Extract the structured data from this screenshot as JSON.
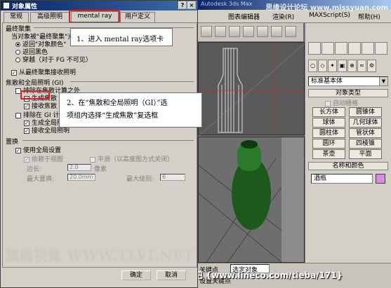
{
  "max_window": {
    "title_watermark": "思缘设计论坛 www.missyuan.com",
    "menu_items": [
      "图表编辑器",
      "渲染(R)",
      "MAXScript(S)",
      "帮助(H)"
    ],
    "selection_dropdown": "选定对象",
    "status_label_1": "关键点",
    "status_label_2": "设置关键点",
    "footer_watermark": "3Dmax吧  {www.lineco.com/tieba/171}"
  },
  "command_panel": {
    "category_dropdown": "标准基本体",
    "object_type_header": "对象类型",
    "auto_grid": "自动栅格",
    "buttons": [
      "长方体",
      "圆锥体",
      "球体",
      "几何球体",
      "圆柱体",
      "管状体",
      "圆环",
      "四棱锥",
      "茶壶",
      "平面"
    ],
    "name_color_header": "名称和颜色",
    "object_name": "酒瓶",
    "swatch_color": "#d98bd8"
  },
  "dialog": {
    "title": "对象属性",
    "tabs": [
      "常规",
      "高级照明",
      "mental ray",
      "用户定义"
    ],
    "active_tab": "mental ray",
    "final_gather_group": "最终聚集",
    "fg_when_hit": "当对象被\"最终聚集\"光线击中时",
    "fg_radio_1": "返回\"对象颜色\"",
    "fg_radio_2": "返回黑色",
    "fg_radio_3": "穿越（对于 FG 不可见）",
    "fg_receive": "从最终聚集接收照明",
    "caustics_group": "焦散和全局照明 (GI)",
    "exclude_caustics": "排除在焦散计算之外",
    "generate_caustics": "生成焦散",
    "receive_caustics": "接收焦散",
    "exclude_gi": "排除在 GI 计算之外",
    "generate_gi": "生成全局照明",
    "receive_gi": "接收全局照明",
    "displacement_group": "置换",
    "use_global": "使用全局设置",
    "view_dependent": "依赖于视图",
    "smoothing": "平滑（以高度图方式关闭）",
    "edge_label": "边长:",
    "edge_value": "2.0",
    "pixels": "像素",
    "max_disp_label": "最大置换:",
    "max_disp_value": "20.0mm",
    "max_level_label": "最大级别:",
    "max_level_value": "6",
    "ok": "确定",
    "cancel": "取消"
  },
  "callouts": {
    "step1": "1、进入 mental ray选项卡",
    "step2_line1": "2、在“焦散和全局照明（GI）”选",
    "step2_line2": "项组内选择“生成焦散”复选框"
  },
  "page_watermark": "騰龍視覺 WWW.TLVI.NET"
}
